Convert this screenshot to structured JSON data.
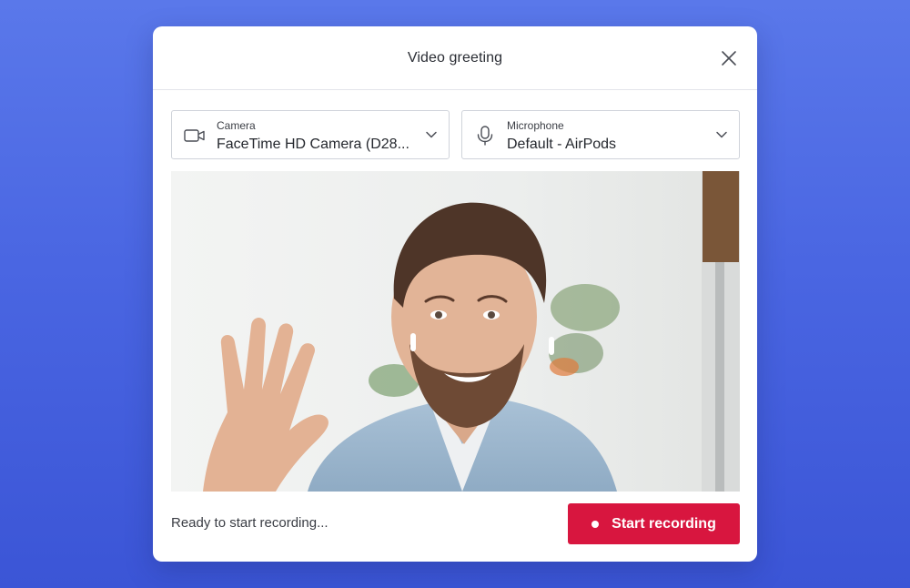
{
  "dialog": {
    "title": "Video greeting"
  },
  "camera": {
    "label": "Camera",
    "value": "FaceTime HD Camera (D28...",
    "icon": "video-camera-icon"
  },
  "microphone": {
    "label": "Microphone",
    "value": "Default - AirPods",
    "icon": "microphone-icon"
  },
  "preview": {
    "content": "camera-preview"
  },
  "footer": {
    "status": "Ready to start recording...",
    "record_label": "Start recording"
  },
  "colors": {
    "accent": "#d8163f",
    "background": "#4a66e2"
  }
}
